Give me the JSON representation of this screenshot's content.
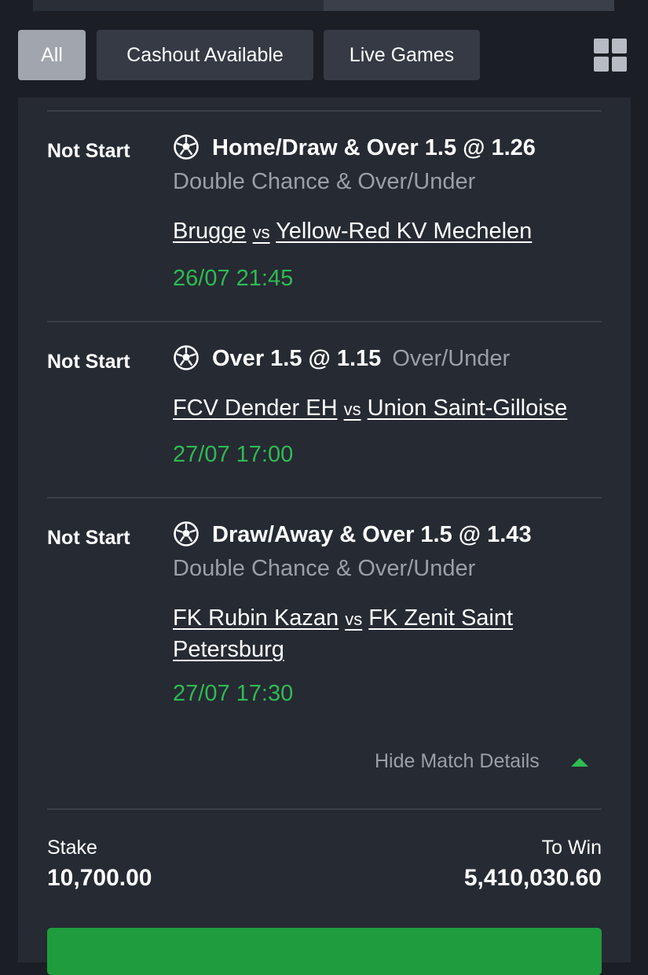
{
  "filters": {
    "all": "All",
    "cashout": "Cashout Available",
    "live": "Live Games"
  },
  "icons": {
    "layout": "grid-view-icon",
    "sport": "soccer-ball-icon",
    "toggle": "caret-up-icon"
  },
  "colors": {
    "accent_green": "#2ebb52",
    "background": "#1b1e24",
    "card": "#262a33"
  },
  "bets": [
    {
      "status": "Not Start",
      "pick": "Home/Draw & Over 1.5 @ 1.26",
      "market": "Double Chance & Over/Under",
      "home": "Brugge",
      "vs": "vs",
      "away": "Yellow-Red KV Mechelen",
      "date": "26/07 21:45"
    },
    {
      "status": "Not Start",
      "pick": "Over 1.5 @ 1.15",
      "market": "Over/Under",
      "home": "FCV Dender EH",
      "vs": "vs",
      "away": "Union Saint-Gilloise",
      "date": "27/07 17:00"
    },
    {
      "status": "Not Start",
      "pick": "Draw/Away & Over 1.5 @ 1.43",
      "market": "Double Chance & Over/Under",
      "home": "FK Rubin Kazan",
      "vs": "vs",
      "away": "FK Zenit Saint Petersburg",
      "date": "27/07 17:30"
    }
  ],
  "details_toggle": "Hide Match Details",
  "summary": {
    "stake_label": "Stake",
    "stake_value": "10,700.00",
    "win_label": "To Win",
    "win_value": "5,410,030.60"
  }
}
